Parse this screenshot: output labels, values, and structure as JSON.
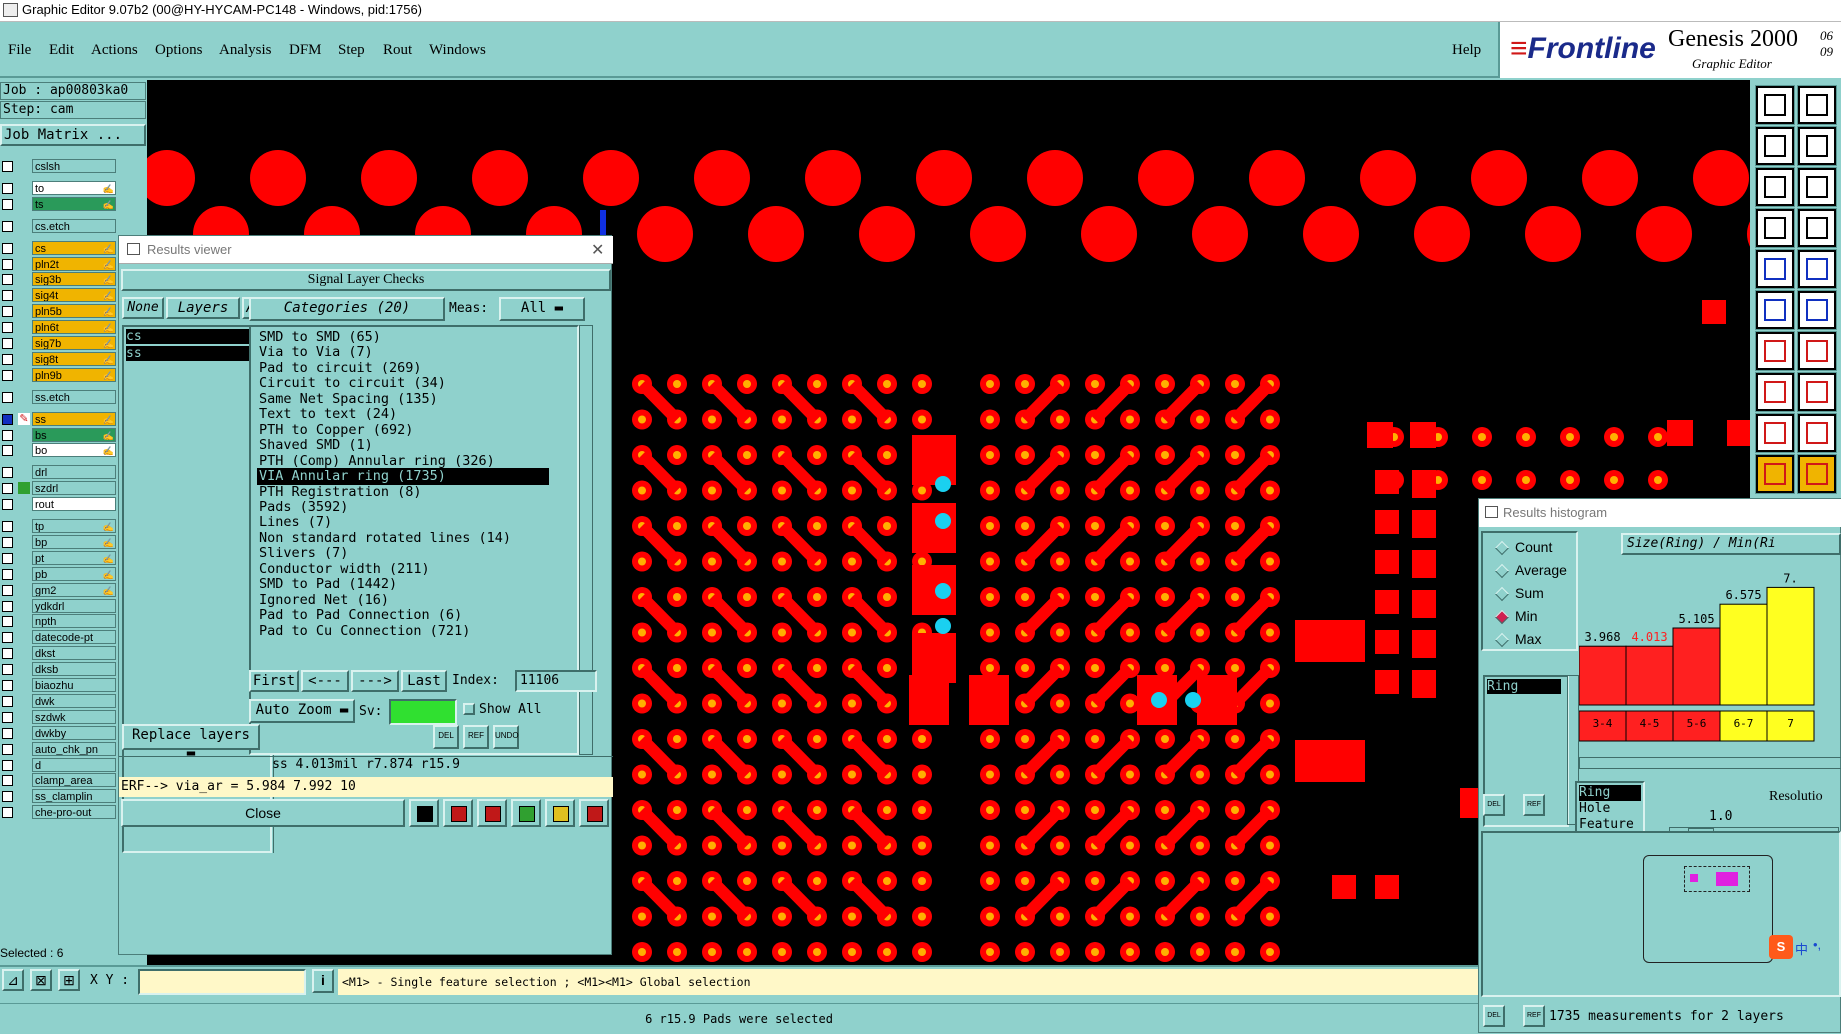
{
  "window": {
    "title": "Graphic Editor 9.07b2 (00@HY-HYCAM-PC148 - Windows, pid:1756)"
  },
  "menu": {
    "items": [
      "File",
      "Edit",
      "Actions",
      "Options",
      "Analysis",
      "DFM",
      "Step",
      "Rout",
      "Windows"
    ],
    "help": "Help"
  },
  "brand": {
    "logo_word": "Frontline",
    "product": "Genesis 2000",
    "subtitle": "Graphic Editor",
    "date1": "06",
    "date2": "09"
  },
  "job": {
    "job_label": "Job : ap00803ka0",
    "step_label": "Step: cam",
    "matrix_button": "Job Matrix ..."
  },
  "layers": [
    {
      "name": "cslsh",
      "color": "#8fd1cc",
      "mark": ""
    },
    {
      "name": "to",
      "color": "#ffffff",
      "mark": "✍"
    },
    {
      "name": "ts",
      "color": "#2a9a5a",
      "mark": "✍"
    },
    {
      "name": "cs.etch",
      "color": "#8fd1cc",
      "mark": ""
    },
    {
      "name": "cs",
      "color": "#f0b400",
      "mark": "✍"
    },
    {
      "name": "pln2t",
      "color": "#f0b400",
      "mark": "✍"
    },
    {
      "name": "sig3b",
      "color": "#f0b400",
      "mark": "✍"
    },
    {
      "name": "sig4t",
      "color": "#f0b400",
      "mark": "✍"
    },
    {
      "name": "pln5b",
      "color": "#f0b400",
      "mark": "✍"
    },
    {
      "name": "pln6t",
      "color": "#f0b400",
      "mark": "✍"
    },
    {
      "name": "sig7b",
      "color": "#f0b400",
      "mark": "✍"
    },
    {
      "name": "sig8t",
      "color": "#f0b400",
      "mark": "✍"
    },
    {
      "name": "pln9b",
      "color": "#f0b400",
      "mark": "✍"
    },
    {
      "name": "ss.etch",
      "color": "#8fd1cc",
      "mark": ""
    },
    {
      "name": "ss",
      "color": "#f0b400",
      "mark": "✍"
    },
    {
      "name": "bs",
      "color": "#2a9a5a",
      "mark": "✍"
    },
    {
      "name": "bo",
      "color": "#ffffff",
      "mark": "✍"
    },
    {
      "name": "drl",
      "color": "#8fd1cc",
      "mark": ""
    },
    {
      "name": "szdrl",
      "color": "#8fd1cc",
      "mark": ""
    },
    {
      "name": "rout",
      "color": "#ffffff",
      "mark": ""
    },
    {
      "name": "tp",
      "color": "#8fd1cc",
      "mark": "✍"
    },
    {
      "name": "bp",
      "color": "#8fd1cc",
      "mark": "✍"
    },
    {
      "name": "pt",
      "color": "#8fd1cc",
      "mark": "✍"
    },
    {
      "name": "pb",
      "color": "#8fd1cc",
      "mark": "✍"
    },
    {
      "name": "gm2",
      "color": "#8fd1cc",
      "mark": "✍"
    },
    {
      "name": "ydkdrl",
      "color": "#8fd1cc",
      "mark": ""
    },
    {
      "name": "npth",
      "color": "#8fd1cc",
      "mark": ""
    },
    {
      "name": "datecode-pt",
      "color": "#8fd1cc",
      "mark": ""
    },
    {
      "name": "dkst",
      "color": "#8fd1cc",
      "mark": ""
    },
    {
      "name": "dksb",
      "color": "#8fd1cc",
      "mark": ""
    },
    {
      "name": "biaozhu",
      "color": "#8fd1cc",
      "mark": ""
    },
    {
      "name": "dwk",
      "color": "#8fd1cc",
      "mark": ""
    },
    {
      "name": "szdwk",
      "color": "#8fd1cc",
      "mark": ""
    },
    {
      "name": "dwkby",
      "color": "#8fd1cc",
      "mark": ""
    },
    {
      "name": "auto_chk_pn",
      "color": "#8fd1cc",
      "mark": ""
    },
    {
      "name": "d",
      "color": "#8fd1cc",
      "mark": ""
    },
    {
      "name": "clamp_area",
      "color": "#8fd1cc",
      "mark": ""
    },
    {
      "name": "ss_clamplin",
      "color": "#8fd1cc",
      "mark": ""
    },
    {
      "name": "che-pro-out",
      "color": "#8fd1cc",
      "mark": ""
    }
  ],
  "selected_count": "Selected : 6",
  "results_viewer": {
    "title": "Results viewer",
    "section": "Signal Layer Checks",
    "none_btn": "None",
    "layers_btn": "Layers",
    "all_btn": "All",
    "layer_list": [
      "cs",
      "ss"
    ],
    "categories_btn": "Categories (20)",
    "meas_label": "Meas:",
    "meas_value": "All",
    "categories": [
      "SMD to SMD (65)",
      "Via to Via (7)",
      "Pad to circuit (269)",
      "Circuit to circuit (34)",
      "Same Net Spacing (135)",
      "Text to text (24)",
      "PTH to Copper (692)",
      "Shaved SMD (1)",
      "PTH (Comp) Annular ring (326)",
      "VIA Annular ring (1735)",
      "PTH Registration (8)",
      "Pads (3592)",
      "Lines (7)",
      "Non standard rotated lines (14)",
      "Slivers (7)",
      "Conductor width (211)",
      "SMD to Pad (1442)",
      "Ignored Net (16)",
      "Pad to Pad Connection (6)",
      "Pad to Cu Connection (721)"
    ],
    "highlight_index": 9,
    "first_btn": "First",
    "prev_btn": "<---",
    "next_btn": "--->",
    "last_btn": "Last",
    "index_label": "Index:",
    "index_value": "11106",
    "zoom_btn": "Auto Zoom",
    "sv_label": "Sv:",
    "show_all": "Show All",
    "replace_btn": "Replace layers",
    "info_line": "ss 4.013mil  r7.874  r15.9",
    "erf_line": "ERF--> via_ar = 5.984 7.992 10",
    "close_btn": "Close",
    "small_btns": [
      "DEL",
      "REF",
      "UNDO"
    ]
  },
  "results_histogram": {
    "title": "Results histogram",
    "modes": [
      "Count",
      "Average",
      "Sum",
      "Min",
      "Max"
    ],
    "active_mode": "Min",
    "size_label": "Size(Ring) / Min(Ri",
    "list_item": "Ring",
    "bars": [
      {
        "value": "3.968",
        "range": "3-4",
        "color": "#ff2020",
        "height": 0.42
      },
      {
        "value": "4.013",
        "range": "4-5",
        "color": "#ff2020",
        "height": 0.42
      },
      {
        "value": "5.105",
        "range": "5-6",
        "color": "#ff2020",
        "height": 0.55
      },
      {
        "value": "6.575",
        "range": "6-7",
        "color": "#ffff20",
        "height": 0.72
      },
      {
        "value": "7.",
        "range": "7",
        "color": "#ffff20",
        "height": 0.84
      }
    ],
    "value_colors": [
      "#000000",
      "#ff2020",
      "#000000",
      "#000000",
      "#000000"
    ],
    "prop_list": [
      "Ring",
      "Hole",
      "Feature"
    ],
    "resolution_label": "Resolutio",
    "resolution_value": "1.0",
    "del_btn": "DEL",
    "ref_btn": "REF",
    "measurements": "1735 measurements for 2 layers"
  },
  "bottom": {
    "xy_label": "X Y :",
    "hint": "<M1> - Single feature selection ; <M1><M1> Global selection",
    "status": "6 r15.9 Pads were selected"
  },
  "ime": {
    "label": "中"
  }
}
